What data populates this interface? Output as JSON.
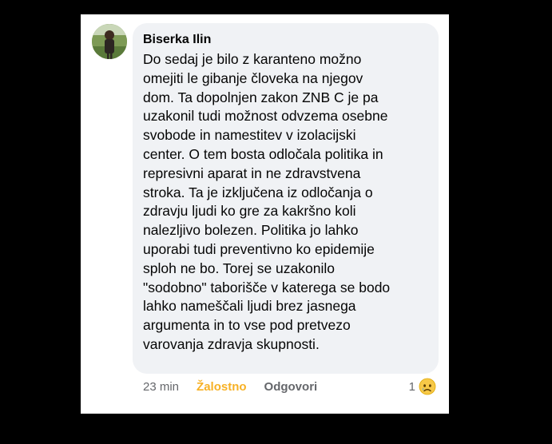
{
  "comment": {
    "author": "Biserka Ilin",
    "lines": [
      "Do sedaj je bilo z karanteno možno",
      "omejiti le gibanje človeka na njegov",
      "dom. Ta dopolnjen zakon ZNB C je pa",
      "uzakonil tudi možnost odvzema osebne",
      "svobode in namestitev v izolacijski",
      "center. O tem bosta odločala politika in",
      "represivni aparat in ne zdravstvena",
      "stroka. Ta je izključena iz odločanja o",
      "zdravju ljudi ko gre za kakršno koli",
      "nalezljivo bolezen. Politika jo lahko",
      "uporabi tudi preventivno ko epidemije",
      "sploh ne bo. Torej se uzakonilo",
      "\"sodobno\" taborišče v katerega se bodo",
      "lahko nameščali ljudi brez jasnega",
      "argumenta in to vse pod pretvezo",
      "varovanja zdravja skupnosti."
    ]
  },
  "actions": {
    "time": "23 min",
    "reaction_label": "Žalostno",
    "reply_label": "Odgovori"
  },
  "reactions": {
    "count": "1",
    "icon": "sad-emoji-icon"
  },
  "colors": {
    "background": "#000000",
    "card": "#ffffff",
    "bubble": "#f0f2f5",
    "reaction_accent": "#f7b125",
    "meta_text": "#65676b"
  }
}
